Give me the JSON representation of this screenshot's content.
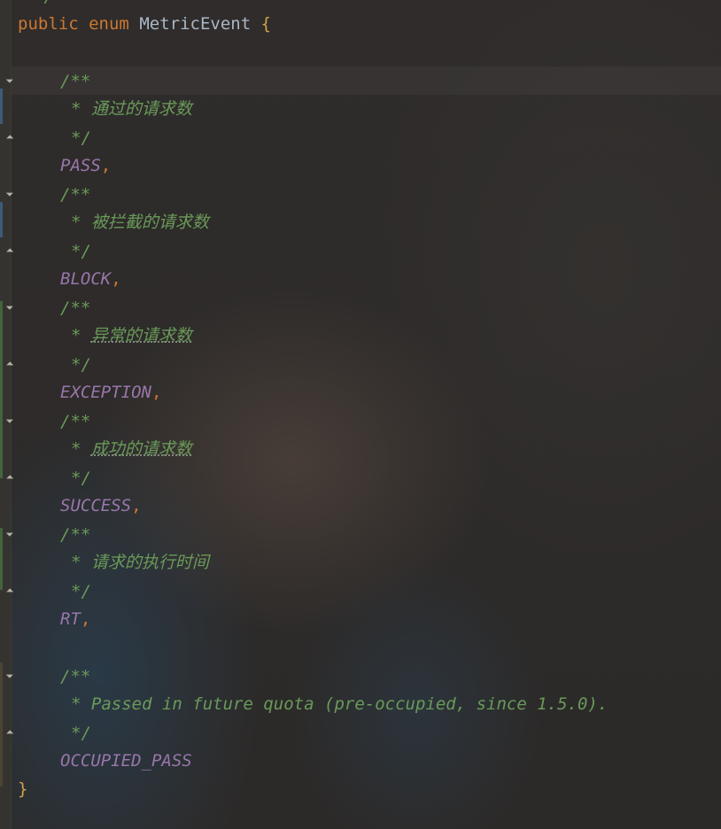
{
  "editor": {
    "top_fragment": "*/",
    "declaration": {
      "modifier": "public",
      "keyword": "enum",
      "name": "MetricEvent",
      "open_brace": "{"
    },
    "comment_open": "/**",
    "comment_close": "*/",
    "bullet": "*",
    "members": [
      {
        "comment": "通过的请求数",
        "name": "PASS",
        "sep": ","
      },
      {
        "comment": "被拦截的请求数",
        "name": "BLOCK",
        "sep": ","
      },
      {
        "comment": "异常的请求数",
        "name": "EXCEPTION",
        "sep": ","
      },
      {
        "comment": "成功的请求数",
        "name": "SUCCESS",
        "sep": ","
      },
      {
        "comment": "请求的执行时间",
        "name": "RT",
        "sep": ","
      },
      {
        "comment": "Passed in future quota (pre-occupied, since 1.5.0).",
        "name": "OCCUPIED_PASS",
        "sep": ""
      }
    ],
    "close_brace": "}"
  },
  "colors": {
    "keyword": "#cc7832",
    "doc_comment": "#6a9a59",
    "constant": "#9876aa",
    "brace": "#d1a34a"
  },
  "icons": [
    "fold-start-icon",
    "fold-end-icon"
  ]
}
